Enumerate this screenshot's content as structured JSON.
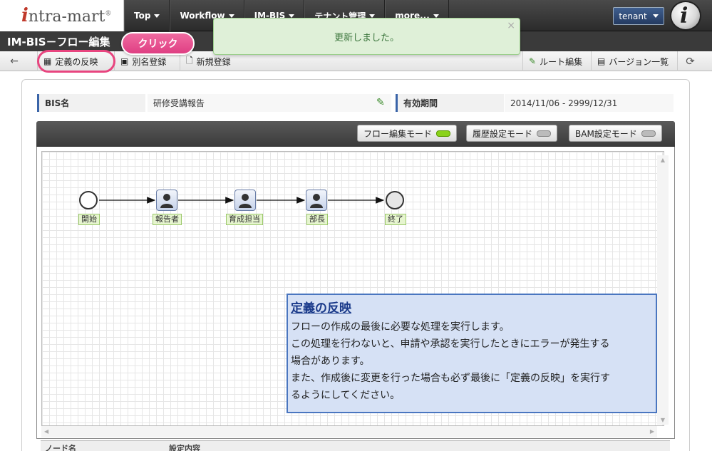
{
  "nav": {
    "logo_i": "i",
    "logo_rest": "ntra-mart",
    "logo_reg": "®",
    "items": [
      {
        "label": "Top"
      },
      {
        "label": "Workflow"
      },
      {
        "label": "IM-BIS"
      },
      {
        "label": "テナント管理"
      },
      {
        "label": "more..."
      }
    ],
    "tenant": "tenant",
    "user_glyph": "i"
  },
  "title": "IM-BIS－フロー編集",
  "toast": {
    "message": "更新しました。",
    "close": "×"
  },
  "callout": {
    "label": "クリック"
  },
  "toolbar": {
    "left": [
      {
        "label": "定義の反映",
        "icon": "reflect-definition-icon"
      },
      {
        "label": "別名登録",
        "icon": "save-as-icon"
      },
      {
        "label": "新規登録",
        "icon": "new-register-icon"
      }
    ],
    "right": [
      {
        "label": "ルート編集",
        "icon": "pencil-icon"
      },
      {
        "label": "バージョン一覧",
        "icon": "list-icon"
      }
    ]
  },
  "info": {
    "bis_label": "BIS名",
    "bis_value": "研修受講報告",
    "period_label": "有効期間",
    "period_value": "2014/11/06 - 2999/12/31"
  },
  "modes": [
    {
      "label": "フロー編集モード",
      "active": true
    },
    {
      "label": "履歴設定モード",
      "active": false
    },
    {
      "label": "BAM設定モード",
      "active": false
    }
  ],
  "flow": {
    "nodes": [
      {
        "label": "開始",
        "kind": "start"
      },
      {
        "label": "報告者",
        "kind": "user"
      },
      {
        "label": "育成担当",
        "kind": "user"
      },
      {
        "label": "部長",
        "kind": "user"
      },
      {
        "label": "終了",
        "kind": "end"
      }
    ]
  },
  "tip": {
    "title": "定義の反映",
    "lines": [
      "フローの作成の最後に必要な処理を実行します。",
      "この処理を行わないと、申請や承認を実行したときにエラーが発生する",
      "場合があります。",
      "また、作成後に変更を行った場合も必ず最後に「定義の反映」を実行す",
      "るようにしてください。"
    ]
  },
  "bottom_table": {
    "columns": [
      "ノード名",
      "設定内容"
    ]
  },
  "colors": {
    "accent": "#3a64a8",
    "toast_bg": "#dff0d8",
    "callout": "#e8457f",
    "tip_bg": "#d6e1f5"
  }
}
